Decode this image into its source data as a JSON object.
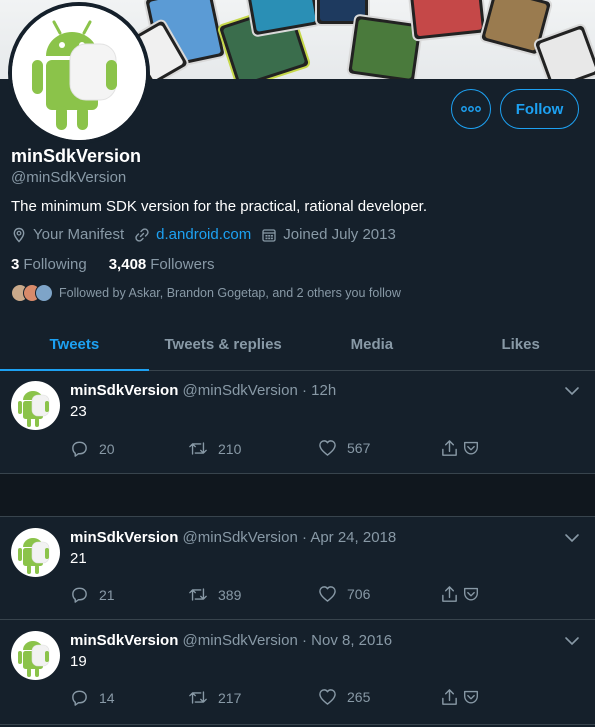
{
  "colors": {
    "background": "#15202b",
    "accent": "#1da1f2",
    "muted": "#8899a6",
    "divider": "#38444d"
  },
  "profile": {
    "name": "minSdkVersion",
    "handle": "@minSdkVersion",
    "bio": "The minimum SDK version for the practical, rational developer.",
    "location": "Your Manifest",
    "website": "d.android.com",
    "joined": "Joined July 2013",
    "following_count": "3",
    "following_label": "Following",
    "followers_count": "3,408",
    "followers_label": "Followers",
    "followed_by": "Followed by Askar, Brandon Gogetap, and 2 others you follow",
    "follow_button": "Follow",
    "more_icon": "more-dots-icon"
  },
  "tabs": [
    {
      "label": "Tweets",
      "active": true
    },
    {
      "label": "Tweets & replies",
      "active": false
    },
    {
      "label": "Media",
      "active": false
    },
    {
      "label": "Likes",
      "active": false
    }
  ],
  "tweets": [
    {
      "name": "minSdkVersion",
      "handle": "@minSdkVersion",
      "time": "· 12h",
      "text": "23",
      "replies": "20",
      "retweets": "210",
      "likes": "567"
    },
    {
      "name": "minSdkVersion",
      "handle": "@minSdkVersion",
      "time": "· Apr 24, 2018",
      "text": "21",
      "replies": "21",
      "retweets": "389",
      "likes": "706"
    },
    {
      "name": "minSdkVersion",
      "handle": "@minSdkVersion",
      "time": "· Nov 8, 2016",
      "text": "19",
      "replies": "14",
      "retweets": "217",
      "likes": "265"
    }
  ]
}
